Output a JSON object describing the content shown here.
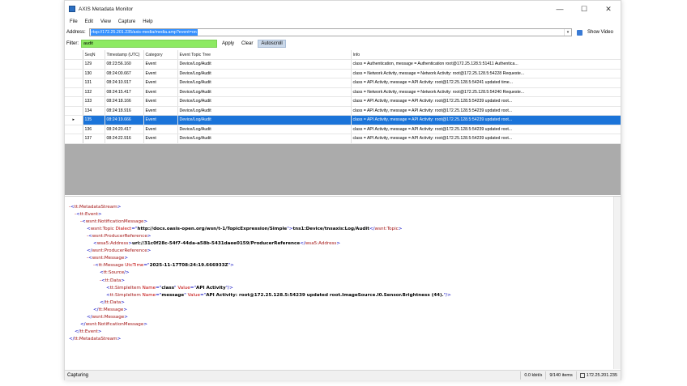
{
  "window": {
    "title": "AXIS Metadata Monitor",
    "controls": {
      "minimize": "—",
      "maximize": "☐",
      "close": "✕"
    }
  },
  "menu": [
    "File",
    "Edit",
    "View",
    "Capture",
    "Help"
  ],
  "address": {
    "label": "Address:",
    "value": "rtsp://172.25.201.235/axis-media/media.amp?event=on",
    "show_video": "Show Video"
  },
  "filter": {
    "label": "Filter:",
    "value": "audit",
    "apply": "Apply",
    "clear": "Clear",
    "autoscroll": "Autoscroll"
  },
  "table": {
    "columns": [
      "SeqN",
      "Timestamp (UTC)",
      "Category",
      "Event Topic Tree",
      "Info"
    ],
    "selected_index": 6,
    "row_marker": "▸",
    "rows": [
      [
        "129",
        "08:23:56.160",
        "Event",
        "Device/Log/Audit",
        "class = Authentication, message = Authentication root@172.25.128.5:51411 Authentica..."
      ],
      [
        "130",
        "08:24:00.667",
        "Event",
        "Device/Log/Audit",
        "class = Network Activity, message = Network Activity: root@172.25.128.5:54228 Requeste..."
      ],
      [
        "131",
        "08:24:10.917",
        "Event",
        "Device/Log/Audit",
        "class = API Activity, message = API Activity: root@172.25.128.5:54241 updated time..."
      ],
      [
        "132",
        "08:24:15.417",
        "Event",
        "Device/Log/Audit",
        "class = Network Activity, message = Network Activity: root@172.25.128.5:54240 Requeste..."
      ],
      [
        "133",
        "08:24:18.166",
        "Event",
        "Device/Log/Audit",
        "class = API Activity, message = API Activity: root@172.25.128.5:54239 updated root..."
      ],
      [
        "134",
        "08:24:18.916",
        "Event",
        "Device/Log/Audit",
        "class = API Activity, message = API Activity: root@172.25.128.5:54239 updated root..."
      ],
      [
        "135",
        "08:24:19.666",
        "Event",
        "Device/Log/Audit",
        "class = API Activity, message = API Activity: root@172.25.128.5:54239 updated root..."
      ],
      [
        "136",
        "08:24:20.417",
        "Event",
        "Device/Log/Audit",
        "class = API Activity, message = API Activity: root@172.25.128.5:54239 updated root..."
      ],
      [
        "137",
        "08:24:22.916",
        "Event",
        "Device/Log/Audit",
        "class = API Activity, message = API Activity: root@172.25.128.5:54239 updated root..."
      ]
    ]
  },
  "xml": {
    "lines": [
      {
        "parts": [
          [
            "m",
            "-"
          ],
          [
            "b",
            "<"
          ],
          [
            "t",
            "tt:MetadataStream"
          ],
          [
            "b",
            ">"
          ]
        ]
      },
      {
        "parts": [
          [
            "m",
            "-"
          ],
          [
            "b",
            "<"
          ],
          [
            "t",
            "tt:Event"
          ],
          [
            "b",
            ">"
          ]
        ]
      },
      {
        "parts": [
          [
            "m",
            "-"
          ],
          [
            "b",
            "<"
          ],
          [
            "t",
            "wsnt:NotificationMessage"
          ],
          [
            "b",
            ">"
          ]
        ]
      },
      {
        "parts": [
          [
            "b",
            "<"
          ],
          [
            "t",
            "wsnt:Topic "
          ],
          [
            "a",
            "Dialect"
          ],
          [
            "b",
            "=\""
          ],
          [
            "v",
            "http://docs.oasis-open.org/wsn/t-1/TopicExpression/Simple"
          ],
          [
            "b",
            "\">"
          ],
          [
            "v",
            "tns1:Device/tnsaxis:Log/Audit"
          ],
          [
            "b",
            "</"
          ],
          [
            "t",
            "wsnt:Topic"
          ],
          [
            "b",
            ">"
          ]
        ]
      },
      {
        "parts": [
          [
            "m",
            "-"
          ],
          [
            "b",
            "<"
          ],
          [
            "t",
            "wsnt:ProducerReference"
          ],
          [
            "b",
            ">"
          ]
        ]
      },
      {
        "parts": [
          [
            "b",
            "<"
          ],
          [
            "t",
            "wsa5:Address"
          ],
          [
            "b",
            ">"
          ],
          [
            "v",
            "uri://31c0f28c-54f7-44da-a58b-5431daee0159/ProducerReference"
          ],
          [
            "b",
            "</"
          ],
          [
            "t",
            "wsa5:Address"
          ],
          [
            "b",
            ">"
          ]
        ]
      },
      {
        "parts": [
          [
            "b",
            "</"
          ],
          [
            "t",
            "wsnt:ProducerReference"
          ],
          [
            "b",
            ">"
          ]
        ]
      },
      {
        "parts": [
          [
            "m",
            "-"
          ],
          [
            "b",
            "<"
          ],
          [
            "t",
            "wsnt:Message"
          ],
          [
            "b",
            ">"
          ]
        ]
      },
      {
        "parts": [
          [
            "m",
            "-"
          ],
          [
            "b",
            "<"
          ],
          [
            "t",
            "tt:Message "
          ],
          [
            "a",
            "UtcTime"
          ],
          [
            "b",
            "=\""
          ],
          [
            "v",
            "2025-11-17T08:24:19.666933Z"
          ],
          [
            "b",
            "\">"
          ]
        ]
      },
      {
        "parts": [
          [
            "b",
            "<"
          ],
          [
            "t",
            "tt:Source"
          ],
          [
            "b",
            "/>"
          ]
        ]
      },
      {
        "parts": [
          [
            "m",
            "-"
          ],
          [
            "b",
            "<"
          ],
          [
            "t",
            "tt:Data"
          ],
          [
            "b",
            ">"
          ]
        ]
      },
      {
        "parts": [
          [
            "b",
            "<"
          ],
          [
            "t",
            "tt:SimpleItem "
          ],
          [
            "a",
            "Name"
          ],
          [
            "b",
            "=\""
          ],
          [
            "v",
            "class"
          ],
          [
            "b",
            "\" "
          ],
          [
            "a",
            "Value"
          ],
          [
            "b",
            "=\""
          ],
          [
            "v",
            "API Activity"
          ],
          [
            "b",
            "\"/>"
          ]
        ]
      },
      {
        "parts": [
          [
            "b",
            "<"
          ],
          [
            "t",
            "tt:SimpleItem "
          ],
          [
            "a",
            "Name"
          ],
          [
            "b",
            "=\""
          ],
          [
            "v",
            "message"
          ],
          [
            "b",
            "\" "
          ],
          [
            "a",
            "Value"
          ],
          [
            "b",
            "=\""
          ],
          [
            "v",
            "API Activity: root@172.25.128.5:54239 updated root.ImageSource.I0.Sensor.Brightness (44)."
          ],
          [
            "b",
            "\"/>"
          ]
        ]
      },
      {
        "parts": [
          [
            "b",
            "</"
          ],
          [
            "t",
            "tt:Data"
          ],
          [
            "b",
            ">"
          ]
        ]
      },
      {
        "parts": [
          [
            "b",
            "</"
          ],
          [
            "t",
            "tt:Message"
          ],
          [
            "b",
            ">"
          ]
        ]
      },
      {
        "parts": [
          [
            "b",
            "</"
          ],
          [
            "t",
            "wsnt:Message"
          ],
          [
            "b",
            ">"
          ]
        ]
      },
      {
        "parts": [
          [
            "b",
            "</"
          ],
          [
            "t",
            "wsnt:NotificationMessage"
          ],
          [
            "b",
            ">"
          ]
        ]
      },
      {
        "parts": [
          [
            "b",
            "</"
          ],
          [
            "t",
            "tt:Event"
          ],
          [
            "b",
            ">"
          ]
        ]
      },
      {
        "parts": [
          [
            "b",
            "</"
          ],
          [
            "t",
            "tt:MetadataStream"
          ],
          [
            "b",
            ">"
          ]
        ]
      }
    ]
  },
  "status": {
    "text": "Capturing",
    "bitrate": "0.0 kbit/s",
    "items": "9/140 items",
    "host": "172.25.201.235"
  }
}
